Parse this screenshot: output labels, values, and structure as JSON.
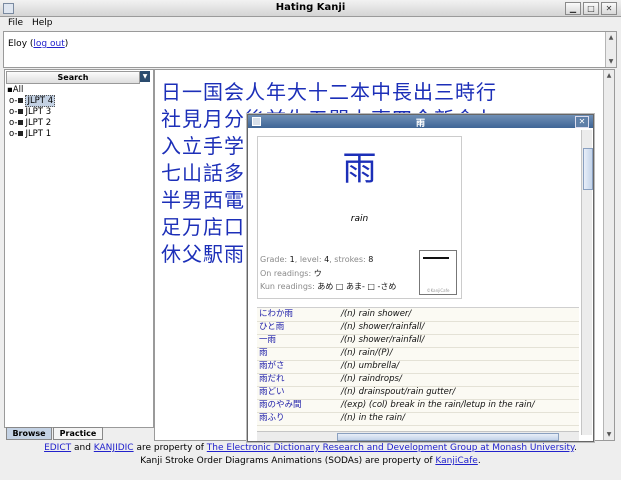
{
  "window": {
    "title": "Hating Kanji"
  },
  "menu": {
    "file": "File",
    "help": "Help"
  },
  "user": {
    "name": "Eloy",
    "open_paren": "(",
    "logout": "log out",
    "close_paren": ")"
  },
  "sidebar": {
    "search_label": "Search",
    "tree": [
      "All",
      "JLPT 4",
      "JLPT 3",
      "JLPT 2",
      "JLPT 1"
    ],
    "tabs": [
      "Browse",
      "Practice"
    ]
  },
  "kanji_rows": [
    "日一国会人年大十二本中長出三時行",
    "社見月分後前生五間上東四今新金九",
    "入立手学",
    "七山話多",
    "半男西電",
    "足万店口",
    "休父駅雨"
  ],
  "dialog": {
    "title": "雨",
    "kanji": "雨",
    "meaning": "rain",
    "grade_label": "Grade:",
    "grade": "1",
    "level_label": ", level:",
    "level": "4",
    "strokes_label": ", strokes:",
    "strokes": "8",
    "on_label": "On readings:",
    "on": "ウ",
    "kun_label": "Kun readings:",
    "kun": "あめ □ あま- □ -さめ",
    "stroke_caption": "©KanjiCafe",
    "entries": [
      {
        "word": "にわか雨",
        "def": "/(n) rain shower/"
      },
      {
        "word": "ひと雨",
        "def": "/(n) shower/rainfall/"
      },
      {
        "word": "一雨",
        "def": "/(n) shower/rainfall/"
      },
      {
        "word": "雨",
        "def": "/(n) rain/(P)/"
      },
      {
        "word": "雨がさ",
        "def": "/(n) umbrella/"
      },
      {
        "word": "雨だれ",
        "def": "/(n) raindrops/"
      },
      {
        "word": "雨どい",
        "def": "/(n) drainspout/rain gutter/"
      },
      {
        "word": "雨のやみ間",
        "def": "/(exp) (col) break in the rain/letup in the rain/"
      },
      {
        "word": "雨ふり",
        "def": "/(n) in the rain/"
      }
    ]
  },
  "footer": {
    "edict": "EDICT",
    "and": " and ",
    "kanjidic": "KANJIDIC",
    "prop": " are property of ",
    "edrdg": "The Electronic Dictionary Research and Development Group at Monash University",
    "period": ".",
    "line2": "Kanji Stroke Order Diagrams Animations (SODAs) are property of ",
    "kanjicafe": "KanjiCafe",
    "period2": "."
  }
}
